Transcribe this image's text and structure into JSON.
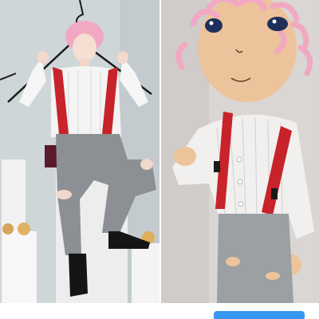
{
  "photos": [
    {
      "subject": "person",
      "description_id": "left-photo"
    },
    {
      "subject": "doll",
      "description_id": "right-photo"
    }
  ],
  "colors": {
    "left_background": "#cfd6d8",
    "right_background": "#d9d6d3",
    "button": "#3897f0",
    "suspenders": "#c8232a",
    "hair": "#f2a8c2",
    "pants": "#8c9095",
    "shirt": "#f4f4f4"
  }
}
